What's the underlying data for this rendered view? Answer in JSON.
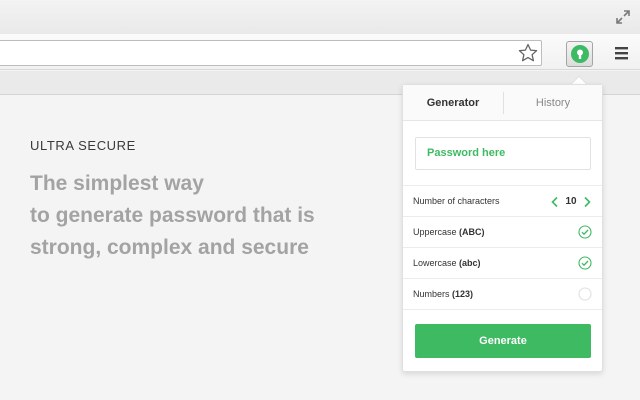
{
  "page": {
    "eyebrow": "ULTRA SECURE",
    "headline": [
      "The simplest way",
      "to generate password that is",
      "strong, complex and secure"
    ]
  },
  "popup": {
    "tabs": [
      "Generator",
      "History"
    ],
    "password_placeholder": "Password here",
    "length": {
      "label": "Number of characters",
      "value": "10"
    },
    "options": [
      {
        "label": "Uppercase",
        "hint": "(ABC)",
        "checked": true
      },
      {
        "label": "Lowercase",
        "hint": "(abc)",
        "checked": true
      },
      {
        "label": "Numbers",
        "hint": "(123)",
        "checked": false
      }
    ],
    "generate_label": "Generate"
  },
  "icons": [
    "fullscreen-icon",
    "star-icon",
    "extension-key-icon",
    "hamburger-menu-icon",
    "chevron-left-icon",
    "chevron-right-icon",
    "check-circle-icon"
  ],
  "colors": {
    "accent": "#3dba62",
    "headline": "#a3a3a3"
  }
}
